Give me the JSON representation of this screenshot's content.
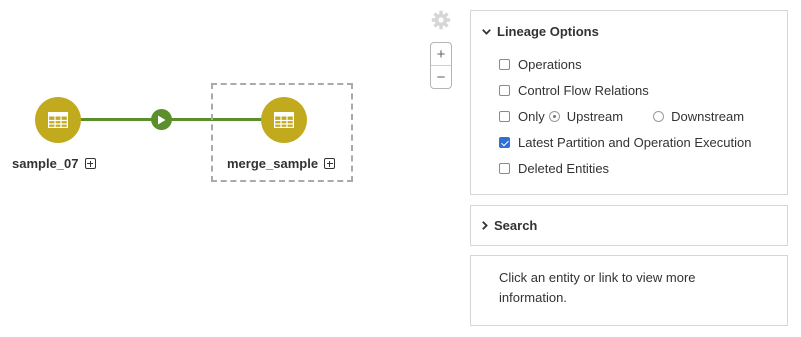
{
  "graph": {
    "nodes": [
      {
        "label": "sample_07",
        "icon": "table-icon"
      },
      {
        "label": "merge_sample",
        "icon": "table-icon"
      }
    ],
    "edge_marker_icon": "play-icon",
    "selected_node": "merge_sample"
  },
  "controls": {
    "settings_icon": "gear-icon",
    "zoom_in": "+",
    "zoom_out": "−"
  },
  "lineage_options": {
    "title": "Lineage Options",
    "operations": {
      "label": "Operations",
      "checked": false
    },
    "control_flow": {
      "label": "Control Flow Relations",
      "checked": false
    },
    "only": {
      "label": "Only",
      "checked": false
    },
    "upstream": {
      "label": "Upstream",
      "selected": true
    },
    "downstream": {
      "label": "Downstream",
      "selected": false
    },
    "latest_partition": {
      "label": "Latest Partition and Operation Execution",
      "checked": true
    },
    "deleted_entities": {
      "label": "Deleted Entities",
      "checked": false
    }
  },
  "search": {
    "title": "Search"
  },
  "info": {
    "text": "Click an entity or link to view more information."
  },
  "colors": {
    "node": "#c2aa1e",
    "edge": "#5a8f2b",
    "checkbox_checked": "#2f6fd6"
  }
}
